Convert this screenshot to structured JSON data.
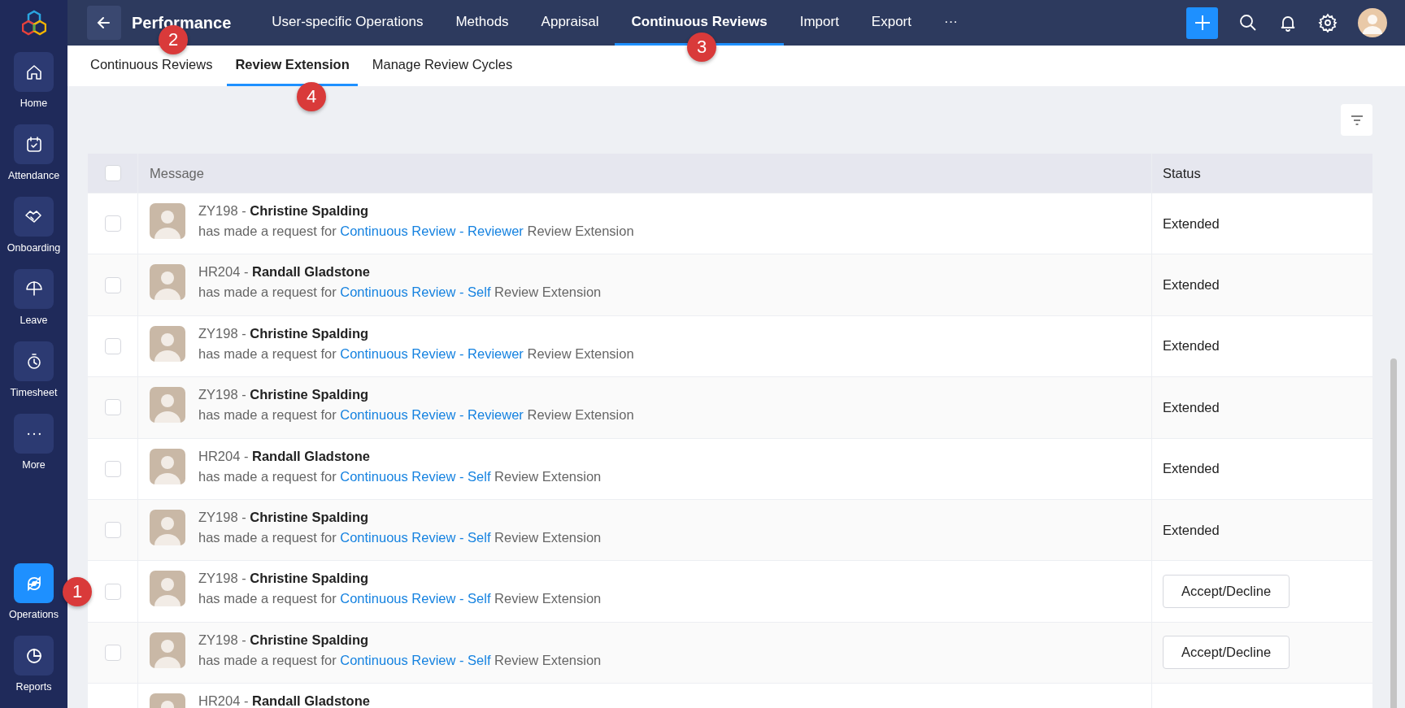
{
  "sidebar": {
    "items": [
      {
        "label": "Home",
        "selected": false
      },
      {
        "label": "Attendance",
        "selected": false
      },
      {
        "label": "Onboarding",
        "selected": false
      },
      {
        "label": "Leave",
        "selected": false
      },
      {
        "label": "Timesheet",
        "selected": false
      },
      {
        "label": "More",
        "selected": false
      }
    ],
    "bottom_items": [
      {
        "label": "Operations",
        "selected": true
      },
      {
        "label": "Reports",
        "selected": false
      }
    ]
  },
  "top_bar": {
    "title": "Performance",
    "tabs": [
      {
        "label": "User-specific Operations",
        "selected": false
      },
      {
        "label": "Methods",
        "selected": false
      },
      {
        "label": "Appraisal",
        "selected": false
      },
      {
        "label": "Continuous Reviews",
        "selected": true
      },
      {
        "label": "Import",
        "selected": false
      },
      {
        "label": "Export",
        "selected": false
      },
      {
        "label": "···",
        "selected": false
      }
    ]
  },
  "sub_tabs": [
    {
      "label": "Continuous Reviews",
      "selected": false
    },
    {
      "label": "Review Extension",
      "selected": true
    },
    {
      "label": "Manage Review Cycles",
      "selected": false
    }
  ],
  "table": {
    "header_checked": false,
    "columns": [
      "Message",
      "Status"
    ],
    "rows": [
      {
        "checked": false,
        "id": "ZY198 -",
        "name": "Christine Spalding",
        "prefix": "has made a request for",
        "link": "Continuous Review - Reviewer",
        "suffix": "Review Extension",
        "status": {
          "kind": "text",
          "label": "Extended"
        }
      },
      {
        "checked": false,
        "id": "HR204 -",
        "name": "Randall Gladstone",
        "prefix": "has made a request for",
        "link": "Continuous Review - Self",
        "suffix": "Review Extension",
        "status": {
          "kind": "text",
          "label": "Extended"
        }
      },
      {
        "checked": false,
        "id": "ZY198 -",
        "name": "Christine Spalding",
        "prefix": "has made a request for",
        "link": "Continuous Review - Reviewer",
        "suffix": "Review Extension",
        "status": {
          "kind": "text",
          "label": "Extended"
        }
      },
      {
        "checked": false,
        "id": "ZY198 -",
        "name": "Christine Spalding",
        "prefix": "has made a request for",
        "link": "Continuous Review - Reviewer",
        "suffix": "Review Extension",
        "status": {
          "kind": "text",
          "label": "Extended"
        }
      },
      {
        "checked": false,
        "id": "HR204 -",
        "name": "Randall Gladstone",
        "prefix": "has made a request for",
        "link": "Continuous Review - Self",
        "suffix": "Review Extension",
        "status": {
          "kind": "text",
          "label": "Extended"
        }
      },
      {
        "checked": false,
        "id": "ZY198 -",
        "name": "Christine Spalding",
        "prefix": "has made a request for",
        "link": "Continuous Review - Self",
        "suffix": "Review Extension",
        "status": {
          "kind": "text",
          "label": "Extended"
        }
      },
      {
        "checked": false,
        "id": "ZY198 -",
        "name": "Christine Spalding",
        "prefix": "has made a request for",
        "link": "Continuous Review - Self",
        "suffix": "Review Extension",
        "status": {
          "kind": "button",
          "label": "Accept/Decline"
        }
      },
      {
        "checked": false,
        "id": "ZY198 -",
        "name": "Christine Spalding",
        "prefix": "has made a request for",
        "link": "Continuous Review - Self",
        "suffix": "Review Extension",
        "status": {
          "kind": "button",
          "label": "Accept/Decline"
        }
      },
      {
        "id": "HR204 -",
        "name": "Randall Gladstone"
      }
    ]
  },
  "callouts": [
    {
      "label": "1"
    },
    {
      "label": "2"
    },
    {
      "label": "3"
    },
    {
      "label": "4"
    }
  ]
}
